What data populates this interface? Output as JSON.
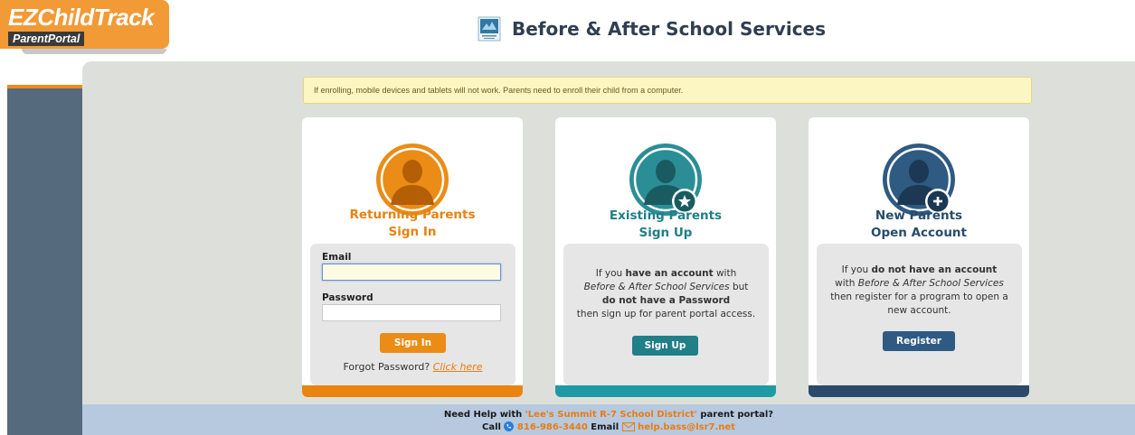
{
  "header": {
    "logo_top": "EZChildTrack",
    "logo_bottom": "ParentPortal",
    "title": "Before & After School Services"
  },
  "notice": "If enrolling, mobile devices and tablets will not work. Parents need to enroll their child from a computer.",
  "cards": {
    "returning": {
      "title_line1": "Returning Parents",
      "title_line2": "Sign In",
      "email_label": "Email",
      "email_value": "",
      "password_label": "Password",
      "password_value": "",
      "signin_button": "Sign In",
      "forgot_text": "Forgot Password?",
      "forgot_link": "Click here"
    },
    "existing": {
      "title_line1": "Existing Parents",
      "title_line2": "Sign Up",
      "desc_1": "If you ",
      "desc_2": "have an account",
      "desc_3": " with",
      "desc_4": "Before & After School Services",
      "desc_5": " but",
      "desc_6": "do not have a Password",
      "desc_7": "then sign up for parent portal access.",
      "signup_button": "Sign Up"
    },
    "new": {
      "title_line1": "New Parents",
      "title_line2": "Open Account",
      "desc_1": "If you ",
      "desc_2": "do not have an account",
      "desc_3": "with ",
      "desc_4": "Before & After School Services",
      "desc_5": "then register for a program to open a new account.",
      "register_button": "Register"
    }
  },
  "footer": {
    "line1_pre": "Need Help with ",
    "district": "'Lee's Summit R-7 School District'",
    "line1_post": " parent portal?",
    "call_label": "Call",
    "phone": "816-986-3440",
    "email_label": "Email",
    "email": "help.bass@lsr7.net"
  },
  "colors": {
    "orange": "#ea8c16",
    "teal": "#217f88",
    "navy": "#274c6d",
    "panel": "#dde0da",
    "footer": "#b6c9df"
  },
  "icons": [
    "school-icon",
    "returning-parent-avatar-icon",
    "existing-parent-avatar-icon",
    "star-icon",
    "new-parent-avatar-icon",
    "plus-icon",
    "phone-icon",
    "mail-icon"
  ]
}
